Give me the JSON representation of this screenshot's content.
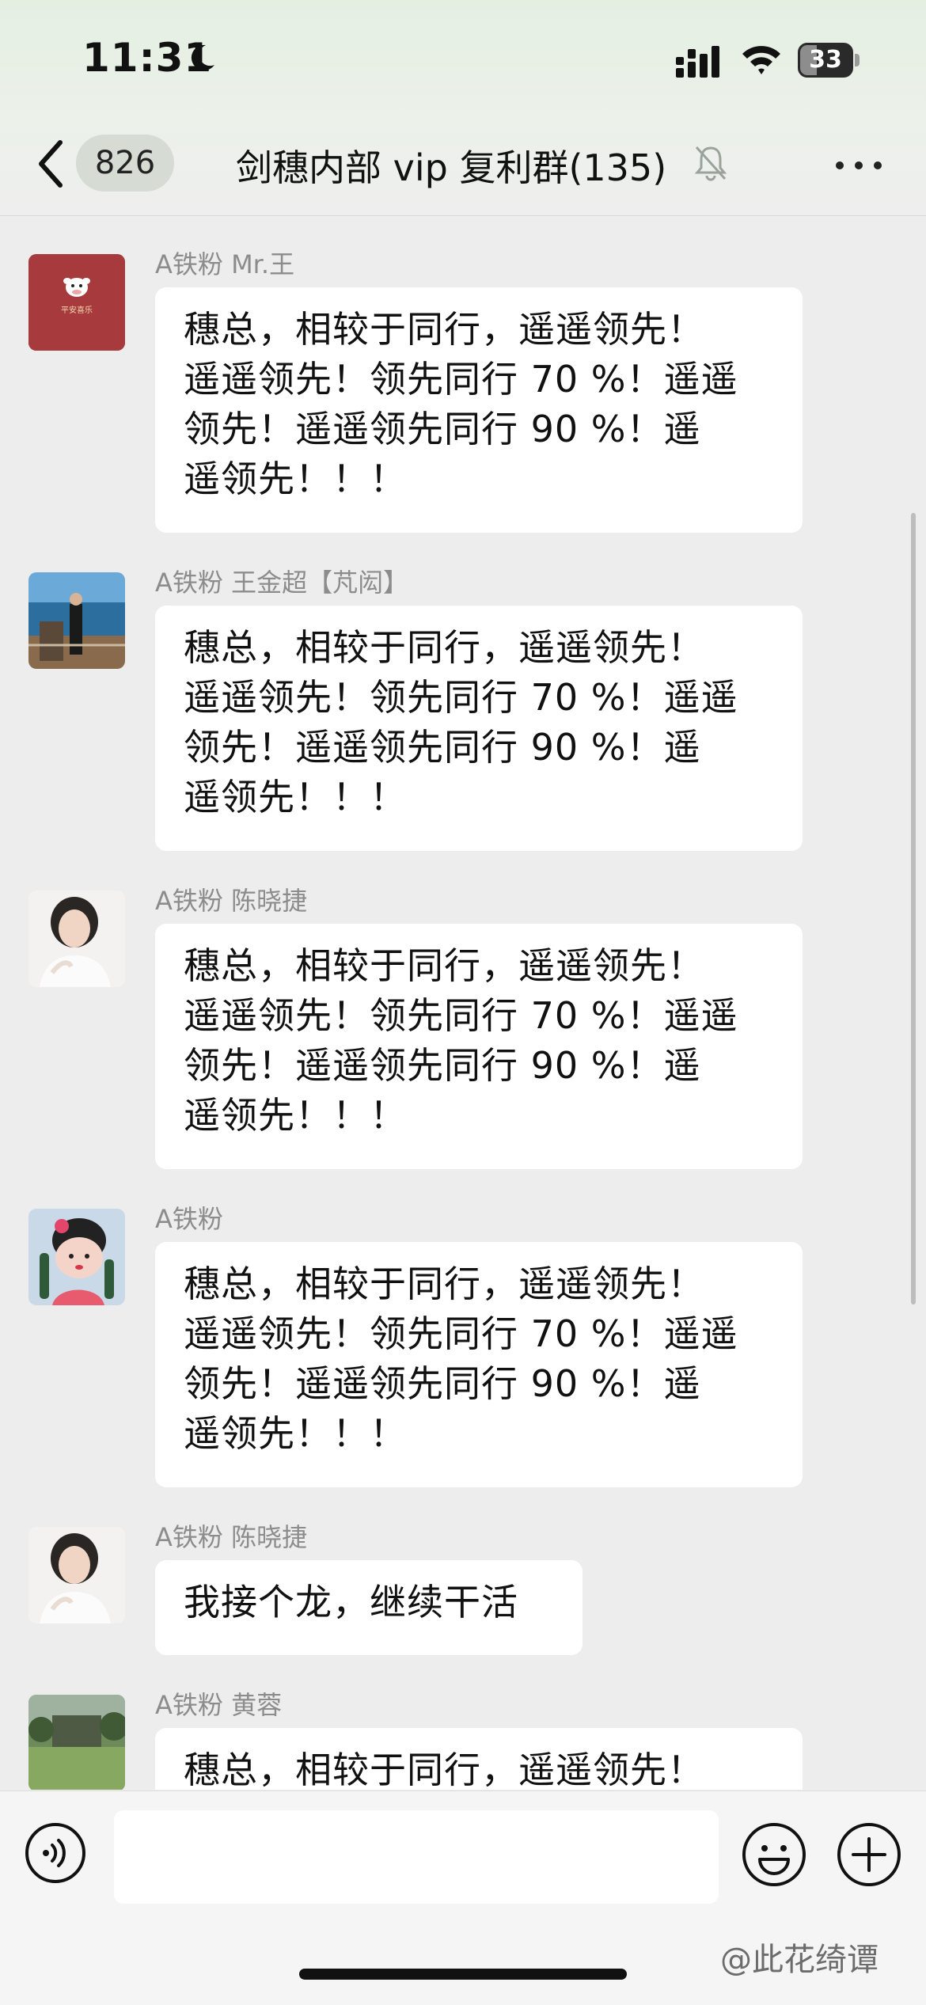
{
  "status_bar": {
    "time": "11:31",
    "battery": "33",
    "battery_level_percent": 33
  },
  "header": {
    "badge": "826",
    "title": "剑穗内部 vip 复利群(135)"
  },
  "messages": [
    {
      "sender": "A铁粉  Mr.王",
      "avatar_text": "平安喜乐",
      "text": "穗总，相较于同行，遥遥领先！\n遥遥领先！领先同行 70 %！遥遥\n领先！遥遥领先同行 90 %！遥\n遥领先！！！"
    },
    {
      "sender": "A铁粉 王金超【芃闳】",
      "text": "穗总，相较于同行，遥遥领先！\n遥遥领先！领先同行 70 %！遥遥\n领先！遥遥领先同行 90 %！遥\n遥领先！！！"
    },
    {
      "sender": "A铁粉  陈晓捷",
      "text": "穗总，相较于同行，遥遥领先！\n遥遥领先！领先同行 70 %！遥遥\n领先！遥遥领先同行 90 %！遥\n遥领先！！！"
    },
    {
      "sender": "A铁粉",
      "text": "穗总，相较于同行，遥遥领先！\n遥遥领先！领先同行 70 %！遥遥\n领先！遥遥领先同行 90 %！遥\n遥领先！！！"
    },
    {
      "sender": "A铁粉  陈晓捷",
      "text": "我接个龙，继续干活"
    },
    {
      "sender": "A铁粉  黄蓉",
      "text": "穗总，相较于同行，遥遥领先！"
    }
  ],
  "watermark": "@此花绮谭"
}
